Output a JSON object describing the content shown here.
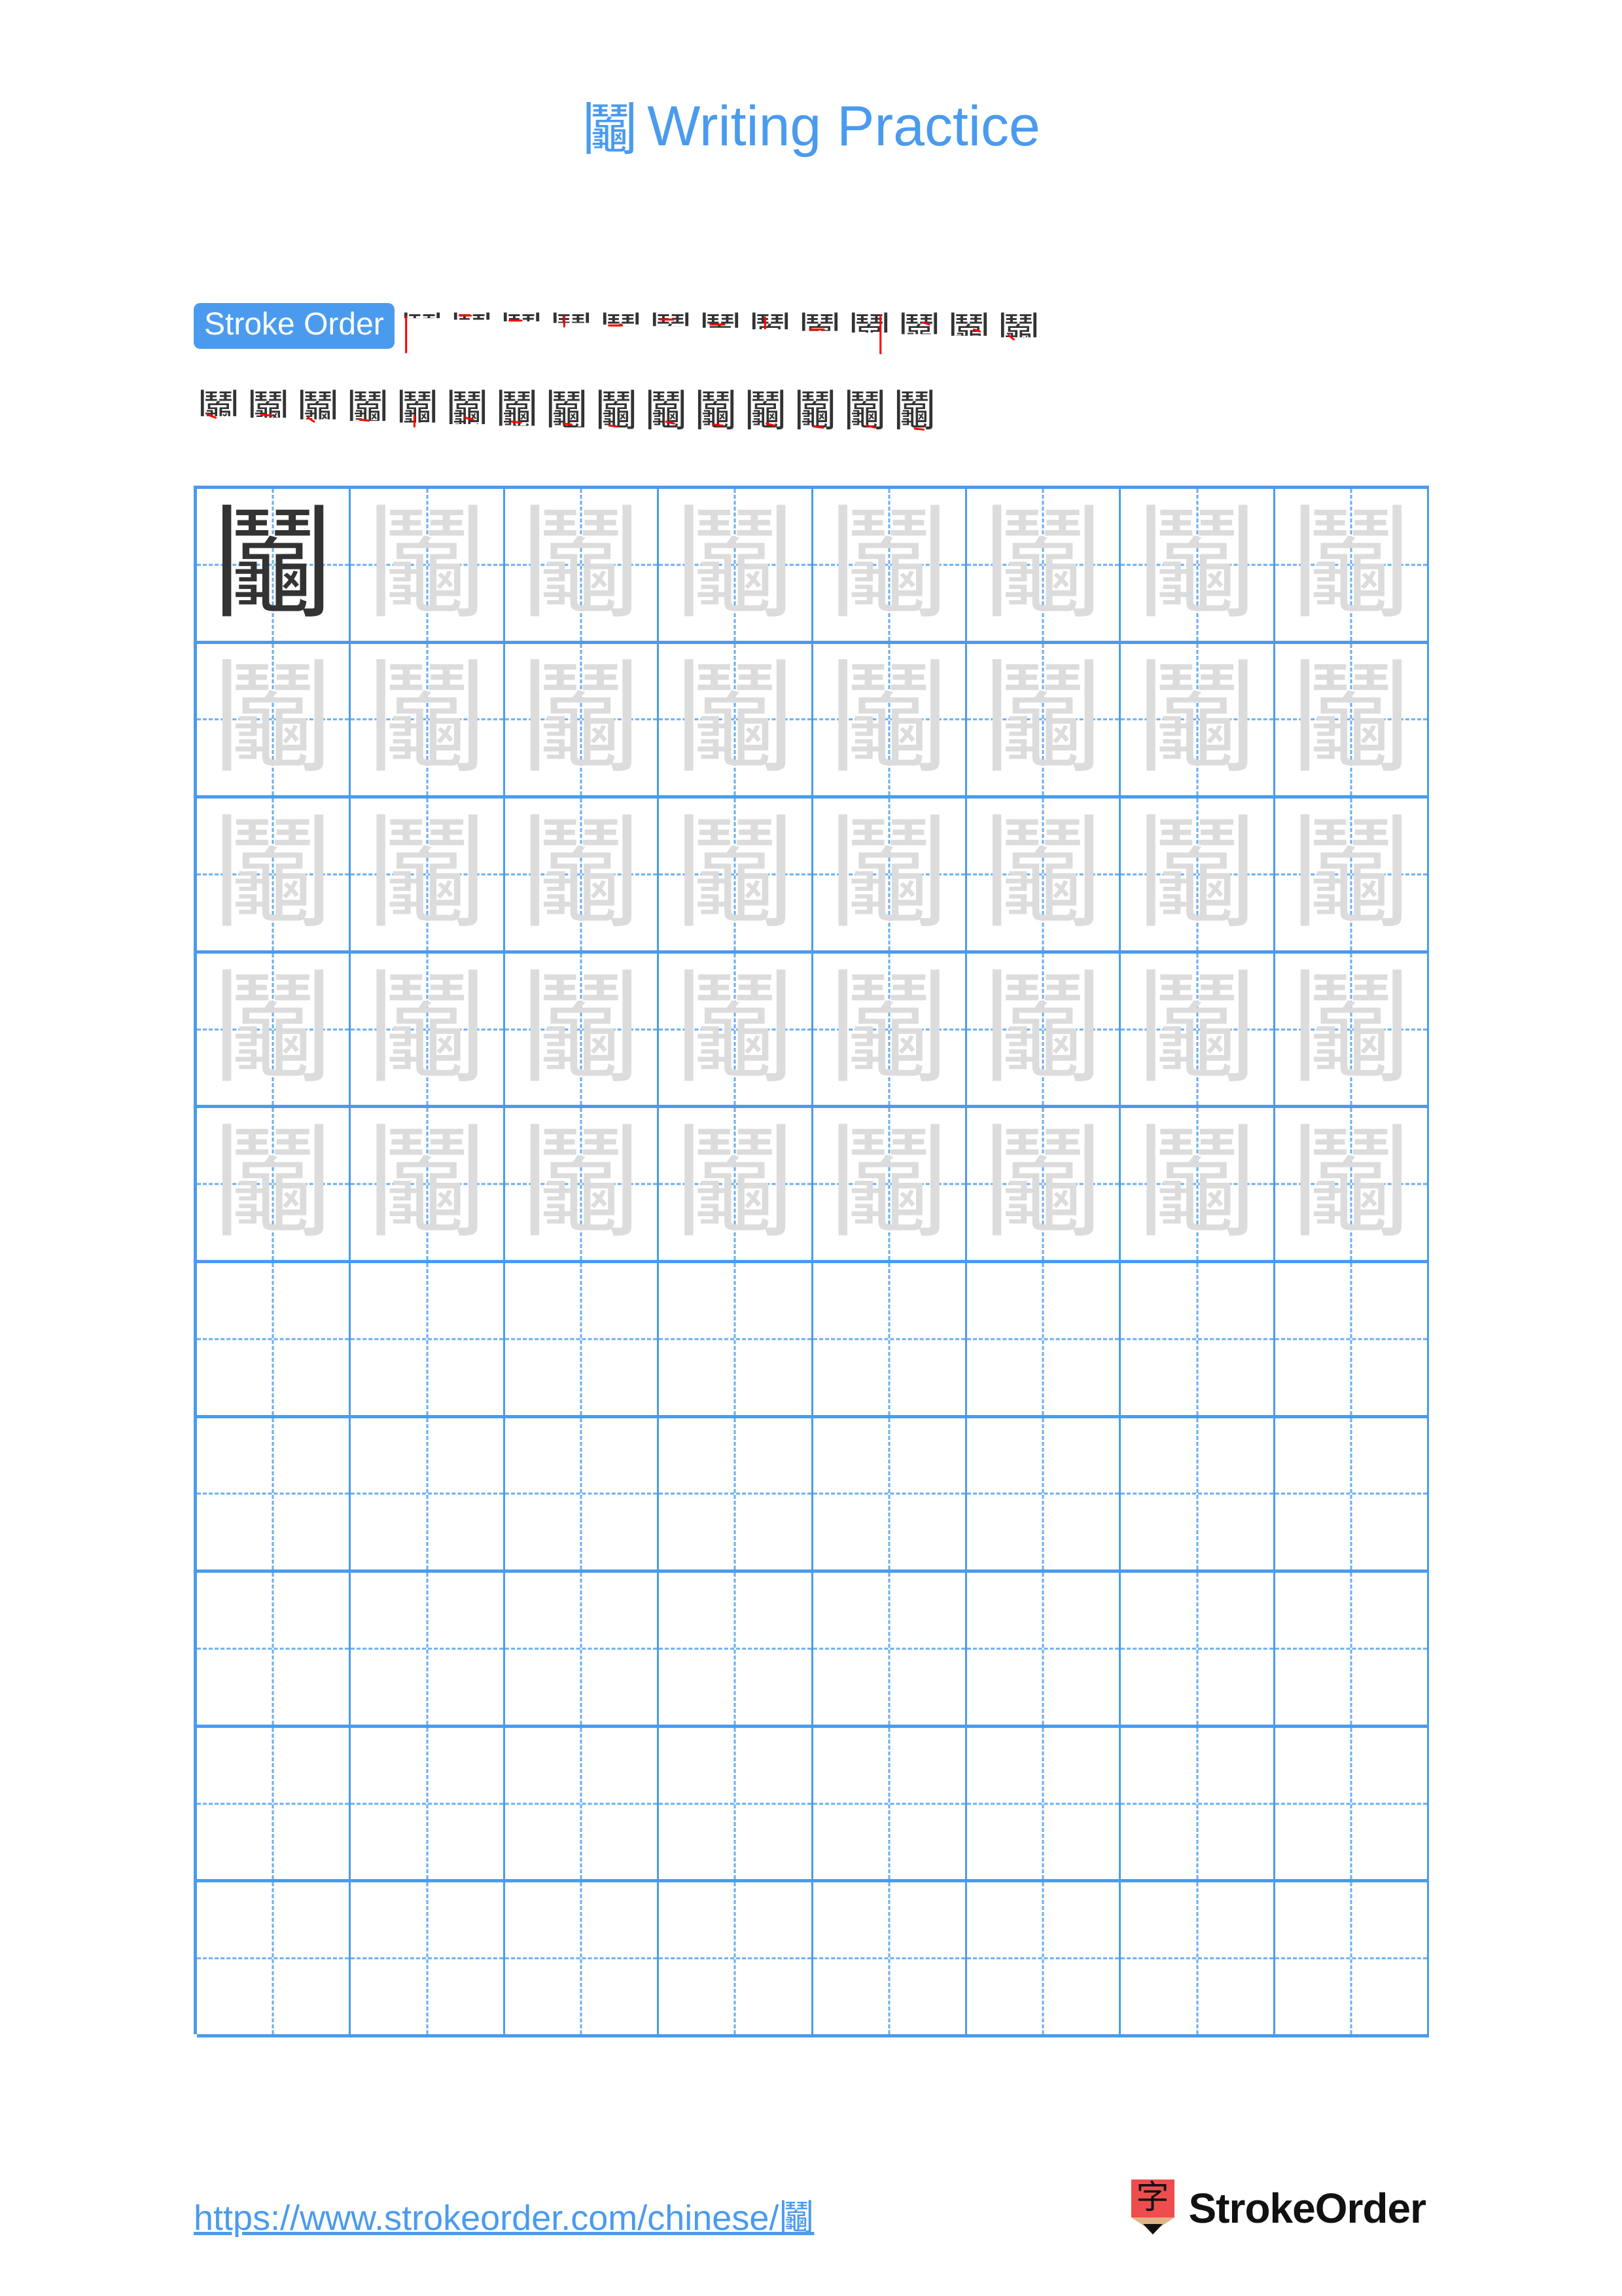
{
  "page": {
    "character": "鬮",
    "title_suffix": "Writing Practice",
    "accent_color": "#4a9bee",
    "ghost_color": "#dcdcdc",
    "dark_color": "#333333",
    "stroke_highlight_color": "#ff0000"
  },
  "stroke_order": {
    "badge_label": "Stroke Order",
    "total_strokes": 28,
    "rows": [
      {
        "steps": [
          1,
          2,
          3,
          4,
          5,
          6,
          7,
          8,
          9,
          10,
          11,
          12,
          13
        ]
      },
      {
        "steps": [
          14,
          15,
          16,
          17,
          18,
          19,
          20,
          21,
          22,
          23,
          24,
          25,
          26,
          27,
          28
        ]
      }
    ]
  },
  "practice_grid": {
    "columns": 8,
    "rows": 10,
    "cells": [
      [
        "dark",
        "ghost",
        "ghost",
        "ghost",
        "ghost",
        "ghost",
        "ghost",
        "ghost"
      ],
      [
        "ghost",
        "ghost",
        "ghost",
        "ghost",
        "ghost",
        "ghost",
        "ghost",
        "ghost"
      ],
      [
        "ghost",
        "ghost",
        "ghost",
        "ghost",
        "ghost",
        "ghost",
        "ghost",
        "ghost"
      ],
      [
        "ghost",
        "ghost",
        "ghost",
        "ghost",
        "ghost",
        "ghost",
        "ghost",
        "ghost"
      ],
      [
        "ghost",
        "ghost",
        "ghost",
        "ghost",
        "ghost",
        "ghost",
        "ghost",
        "ghost"
      ],
      [
        "blank",
        "blank",
        "blank",
        "blank",
        "blank",
        "blank",
        "blank",
        "blank"
      ],
      [
        "blank",
        "blank",
        "blank",
        "blank",
        "blank",
        "blank",
        "blank",
        "blank"
      ],
      [
        "blank",
        "blank",
        "blank",
        "blank",
        "blank",
        "blank",
        "blank",
        "blank"
      ],
      [
        "blank",
        "blank",
        "blank",
        "blank",
        "blank",
        "blank",
        "blank",
        "blank"
      ],
      [
        "blank",
        "blank",
        "blank",
        "blank",
        "blank",
        "blank",
        "blank",
        "blank"
      ]
    ]
  },
  "footer": {
    "url": "https://www.strokeorder.com/chinese/鬮",
    "brand_name": "StrokeOrder",
    "logo_glyph": "字"
  }
}
